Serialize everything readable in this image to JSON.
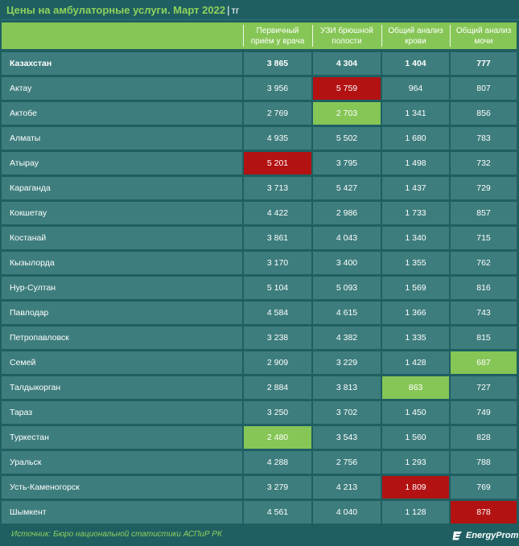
{
  "title": "Цены на амбулаторные услуги. Март 2022",
  "unit": "тг",
  "chart_data": {
    "type": "table",
    "columns": [
      "",
      "Первичный\nприём у врача",
      "УЗИ брюшной\nполости",
      "Общий анализ\nкрови",
      "Общий анализ\nмочи"
    ],
    "rows": [
      {
        "name": "Казахстан",
        "values": [
          "3 865",
          "4 304",
          "1 404",
          "777"
        ],
        "highlight": [
          "",
          "",
          "",
          ""
        ]
      },
      {
        "name": "Актау",
        "values": [
          "3 956",
          "5 759",
          "964",
          "807"
        ],
        "highlight": [
          "",
          "red",
          "",
          ""
        ]
      },
      {
        "name": "Актобе",
        "values": [
          "2 769",
          "2 703",
          "1 341",
          "856"
        ],
        "highlight": [
          "",
          "green",
          "",
          ""
        ]
      },
      {
        "name": "Алматы",
        "values": [
          "4 935",
          "5 502",
          "1 680",
          "783"
        ],
        "highlight": [
          "",
          "",
          "",
          ""
        ]
      },
      {
        "name": "Атырау",
        "values": [
          "5 201",
          "3 795",
          "1 498",
          "732"
        ],
        "highlight": [
          "red",
          "",
          "",
          ""
        ]
      },
      {
        "name": "Караганда",
        "values": [
          "3 713",
          "5 427",
          "1 437",
          "729"
        ],
        "highlight": [
          "",
          "",
          "",
          ""
        ]
      },
      {
        "name": "Кокшетау",
        "values": [
          "4 422",
          "2 986",
          "1 733",
          "857"
        ],
        "highlight": [
          "",
          "",
          "",
          ""
        ]
      },
      {
        "name": "Костанай",
        "values": [
          "3 861",
          "4 043",
          "1 340",
          "715"
        ],
        "highlight": [
          "",
          "",
          "",
          ""
        ]
      },
      {
        "name": "Кызылорда",
        "values": [
          "3 170",
          "3 400",
          "1 355",
          "762"
        ],
        "highlight": [
          "",
          "",
          "",
          ""
        ]
      },
      {
        "name": "Нур-Султан",
        "values": [
          "5 104",
          "5 093",
          "1 569",
          "816"
        ],
        "highlight": [
          "",
          "",
          "",
          ""
        ]
      },
      {
        "name": "Павлодар",
        "values": [
          "4 584",
          "4 615",
          "1 366",
          "743"
        ],
        "highlight": [
          "",
          "",
          "",
          ""
        ]
      },
      {
        "name": "Петропавловск",
        "values": [
          "3 238",
          "4 382",
          "1 335",
          "815"
        ],
        "highlight": [
          "",
          "",
          "",
          ""
        ]
      },
      {
        "name": "Семей",
        "values": [
          "2 909",
          "3 229",
          "1 428",
          "687"
        ],
        "highlight": [
          "",
          "",
          "",
          "green"
        ]
      },
      {
        "name": "Талдыкорган",
        "values": [
          "2 884",
          "3 813",
          "863",
          "727"
        ],
        "highlight": [
          "",
          "",
          "green",
          ""
        ]
      },
      {
        "name": "Тараз",
        "values": [
          "3 250",
          "3 702",
          "1 450",
          "749"
        ],
        "highlight": [
          "",
          "",
          "",
          ""
        ]
      },
      {
        "name": "Туркестан",
        "values": [
          "2 480",
          "3 543",
          "1 560",
          "828"
        ],
        "highlight": [
          "green",
          "",
          "",
          ""
        ]
      },
      {
        "name": "Уральск",
        "values": [
          "4 288",
          "2 756",
          "1 293",
          "788"
        ],
        "highlight": [
          "",
          "",
          "",
          ""
        ]
      },
      {
        "name": "Усть-Каменогорск",
        "values": [
          "3 279",
          "4 213",
          "1 809",
          "769"
        ],
        "highlight": [
          "",
          "",
          "red",
          ""
        ]
      },
      {
        "name": "Шымкент",
        "values": [
          "4 561",
          "4 040",
          "1 128",
          "878"
        ],
        "highlight": [
          "",
          "",
          "",
          "red"
        ]
      }
    ]
  },
  "source": "Источник: Бюро национальной статистики АСПиР РК",
  "logo": "EnergyProm",
  "colors": {
    "background": "#1f5f62",
    "cell": "#3e7d7d",
    "accent_green": "#86c656",
    "title_green": "#8ed25c",
    "highlight_red": "#b31212"
  }
}
